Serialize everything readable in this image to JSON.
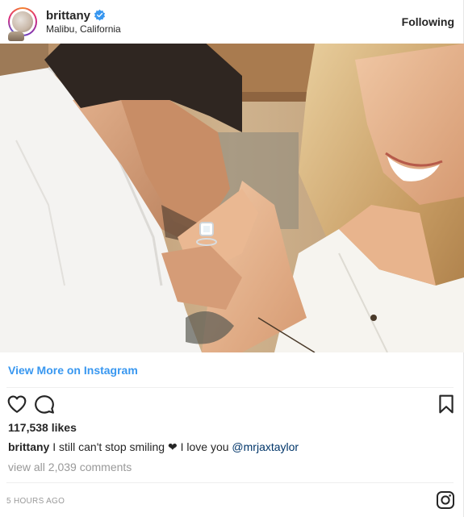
{
  "header": {
    "username": "brittany",
    "location": "Malibu, California",
    "follow_label": "Following",
    "verified_color": "#3897f0"
  },
  "post": {
    "view_more_label": "View More on Instagram",
    "likes": "117,538 likes",
    "caption": {
      "user": "brittany",
      "text": "I still can't stop smiling",
      "emoji": "❤",
      "after": "I love you",
      "mention": "@mrjaxtaylor"
    },
    "comments_link": "view all 2,039 comments",
    "timestamp": "5 HOURS AGO"
  },
  "icons": {
    "like": "heart-icon",
    "comment": "comment-icon",
    "save": "bookmark-icon",
    "brand": "instagram-logo-icon",
    "verified": "verified-badge-icon"
  },
  "colors": {
    "link": "#3897f0",
    "muted": "#999999",
    "text": "#262626",
    "mention": "#003569"
  }
}
